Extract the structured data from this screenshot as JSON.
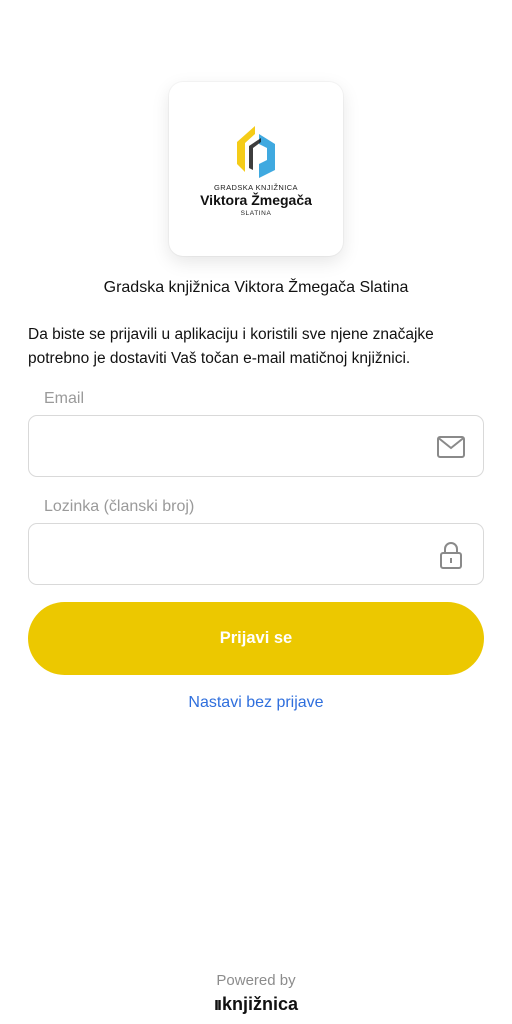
{
  "logo": {
    "small_text": "GRADSKA KNJIŽNICA",
    "main_text": "Viktora Žmegača",
    "city_text": "SLATINA",
    "colors": {
      "yellow": "#F5CC18",
      "blue": "#3FA9E0"
    }
  },
  "library_name": "Gradska knjižnica Viktora Žmegača Slatina",
  "intro_text": "Da biste se prijavili u aplikaciju i koristili sve njene značajke potrebno je dostaviti Vaš točan e-mail matičnoj knjižnici.",
  "email": {
    "label": "Email",
    "value": "",
    "icon": "envelope-icon"
  },
  "password": {
    "label": "Lozinka (članski broj)",
    "value": "",
    "icon": "lock-icon"
  },
  "login_button": {
    "label": "Prijavi se",
    "color": "#ECC800"
  },
  "skip_link": {
    "label": "Nastavi bez prijave",
    "color": "#2F6FDD"
  },
  "footer": {
    "powered_by": "Powered by",
    "brand_mark": "ıı",
    "brand_name": "knjižnica"
  }
}
